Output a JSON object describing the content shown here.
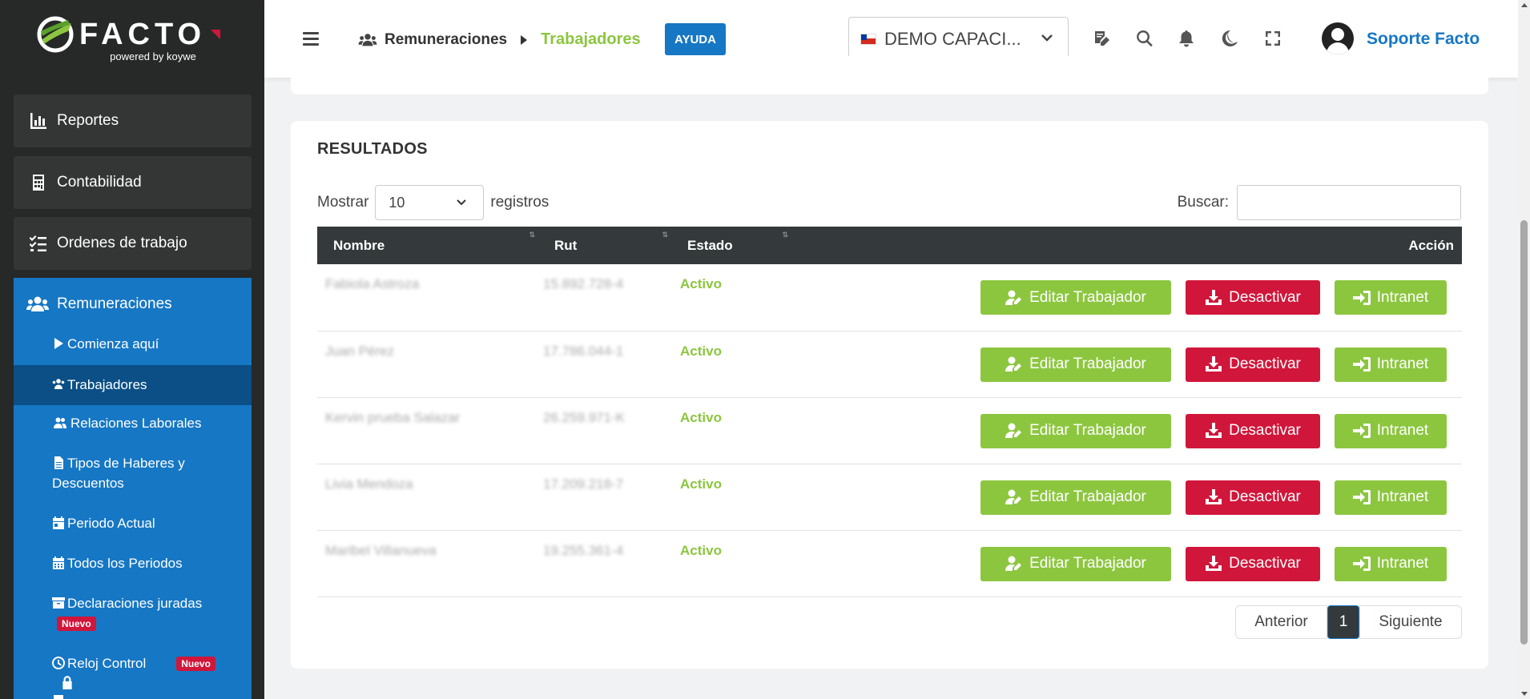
{
  "brand": {
    "name": "FACTO",
    "powered_by": "powered by koywe"
  },
  "sidebar": {
    "items": [
      {
        "label": "Reportes",
        "icon": "chart-bar-icon"
      },
      {
        "label": "Contabilidad",
        "icon": "calculator-icon"
      },
      {
        "label": "Ordenes de trabajo",
        "icon": "tasks-icon"
      }
    ],
    "section": {
      "label": "Remuneraciones",
      "icon": "users-icon"
    },
    "sub_items": [
      {
        "label": "Comienza aquí",
        "icon": "play-icon"
      },
      {
        "label": "Trabajadores",
        "icon": "users-icon",
        "active": true
      },
      {
        "label": "Relaciones Laborales",
        "icon": "user-friends-icon"
      },
      {
        "label": "Tipos de Haberes y Descuentos",
        "icon": "file-icon"
      },
      {
        "label": "Periodo Actual",
        "icon": "calendar-day-icon"
      },
      {
        "label": "Todos los Periodos",
        "icon": "calendar-icon"
      },
      {
        "label": "Declaraciones juradas",
        "icon": "archive-icon",
        "badge": "Nuevo"
      },
      {
        "label": "Reloj Control",
        "icon": "clock-icon",
        "badge": "Nuevo"
      }
    ]
  },
  "header": {
    "breadcrumb_parent": "Remuneraciones",
    "breadcrumb_current": "Trabajadores",
    "help_label": "AYUDA",
    "company": "DEMO CAPACI...",
    "user_name": "Soporte Facto"
  },
  "results": {
    "title": "RESULTADOS",
    "show_label": "Mostrar",
    "page_size": "10",
    "records_label": "registros",
    "search_label": "Buscar:",
    "columns": {
      "name": "Nombre",
      "rut": "Rut",
      "state": "Estado",
      "action": "Acción"
    },
    "rows": [
      {
        "name": "Fabiola Astroza",
        "rut": "15.892.728-4",
        "state": "Activo"
      },
      {
        "name": "Juan Pérez",
        "rut": "17.786.044-1",
        "state": "Activo"
      },
      {
        "name": "Kervin prueba Salazar",
        "rut": "26.259.971-K",
        "state": "Activo"
      },
      {
        "name": "Livia Mendoza",
        "rut": "17.209.218-7",
        "state": "Activo"
      },
      {
        "name": "Maribel Villanueva",
        "rut": "19.255.361-4",
        "state": "Activo"
      }
    ],
    "buttons": {
      "edit": "Editar Trabajador",
      "deactivate": "Desactivar",
      "intranet": "Intranet"
    },
    "pager": {
      "prev": "Anterior",
      "current": "1",
      "next": "Siguiente"
    }
  },
  "colors": {
    "accent_blue": "#1677c4",
    "accent_green": "#8cc63f",
    "danger": "#d0163a",
    "sidebar_bg": "#272828"
  }
}
